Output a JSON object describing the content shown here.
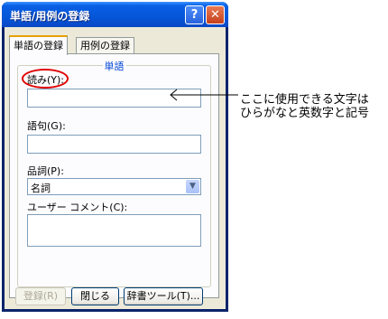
{
  "window": {
    "title": "単語/用例の登録",
    "help_label": "?",
    "close_label": "✕"
  },
  "tabs": [
    {
      "label": "単語の登録",
      "active": true
    },
    {
      "label": "用例の登録",
      "active": false
    }
  ],
  "group": {
    "title": "単語",
    "reading_label": "読み(Y):",
    "reading_value": "",
    "phrase_label": "語句(G):",
    "phrase_value": "",
    "pos_label": "品詞(P):",
    "pos_value": "名詞",
    "comment_label": "ユーザー コメント(C):",
    "comment_value": ""
  },
  "buttons": {
    "register": "登録(R)",
    "close": "閉じる",
    "tools": "辞書ツール(T)..."
  },
  "annotation": {
    "line1": "ここに使用できる文字は",
    "line2": "ひらがなと英数字と記号",
    "highlight_color": "#e00000"
  },
  "icons": {
    "dropdown": "chevron-down-icon",
    "pointer": "arrow-left-icon"
  }
}
